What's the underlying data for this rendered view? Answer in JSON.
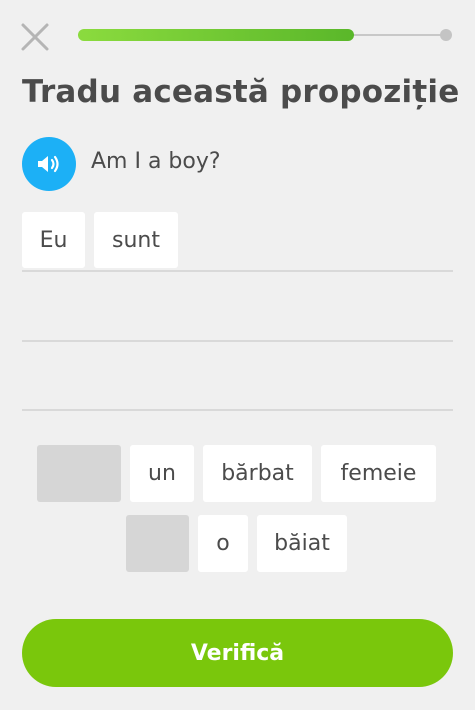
{
  "header": {
    "close_icon": "close-icon",
    "progress_fraction": 0.75
  },
  "title": "Tradu această propoziție",
  "prompt": {
    "speaker_icon": "speaker-icon",
    "text": "Am I a boy?"
  },
  "answer_tiles": [
    "Eu",
    "sunt"
  ],
  "word_bank": [
    "un",
    "bărbat",
    "femeie",
    "o",
    "băiat"
  ],
  "footer": {
    "check_label": "Verifică"
  },
  "colors": {
    "accent_green": "#7ac70c",
    "progress_green": "#5ab72a",
    "speaker_blue": "#1cb0f6"
  }
}
